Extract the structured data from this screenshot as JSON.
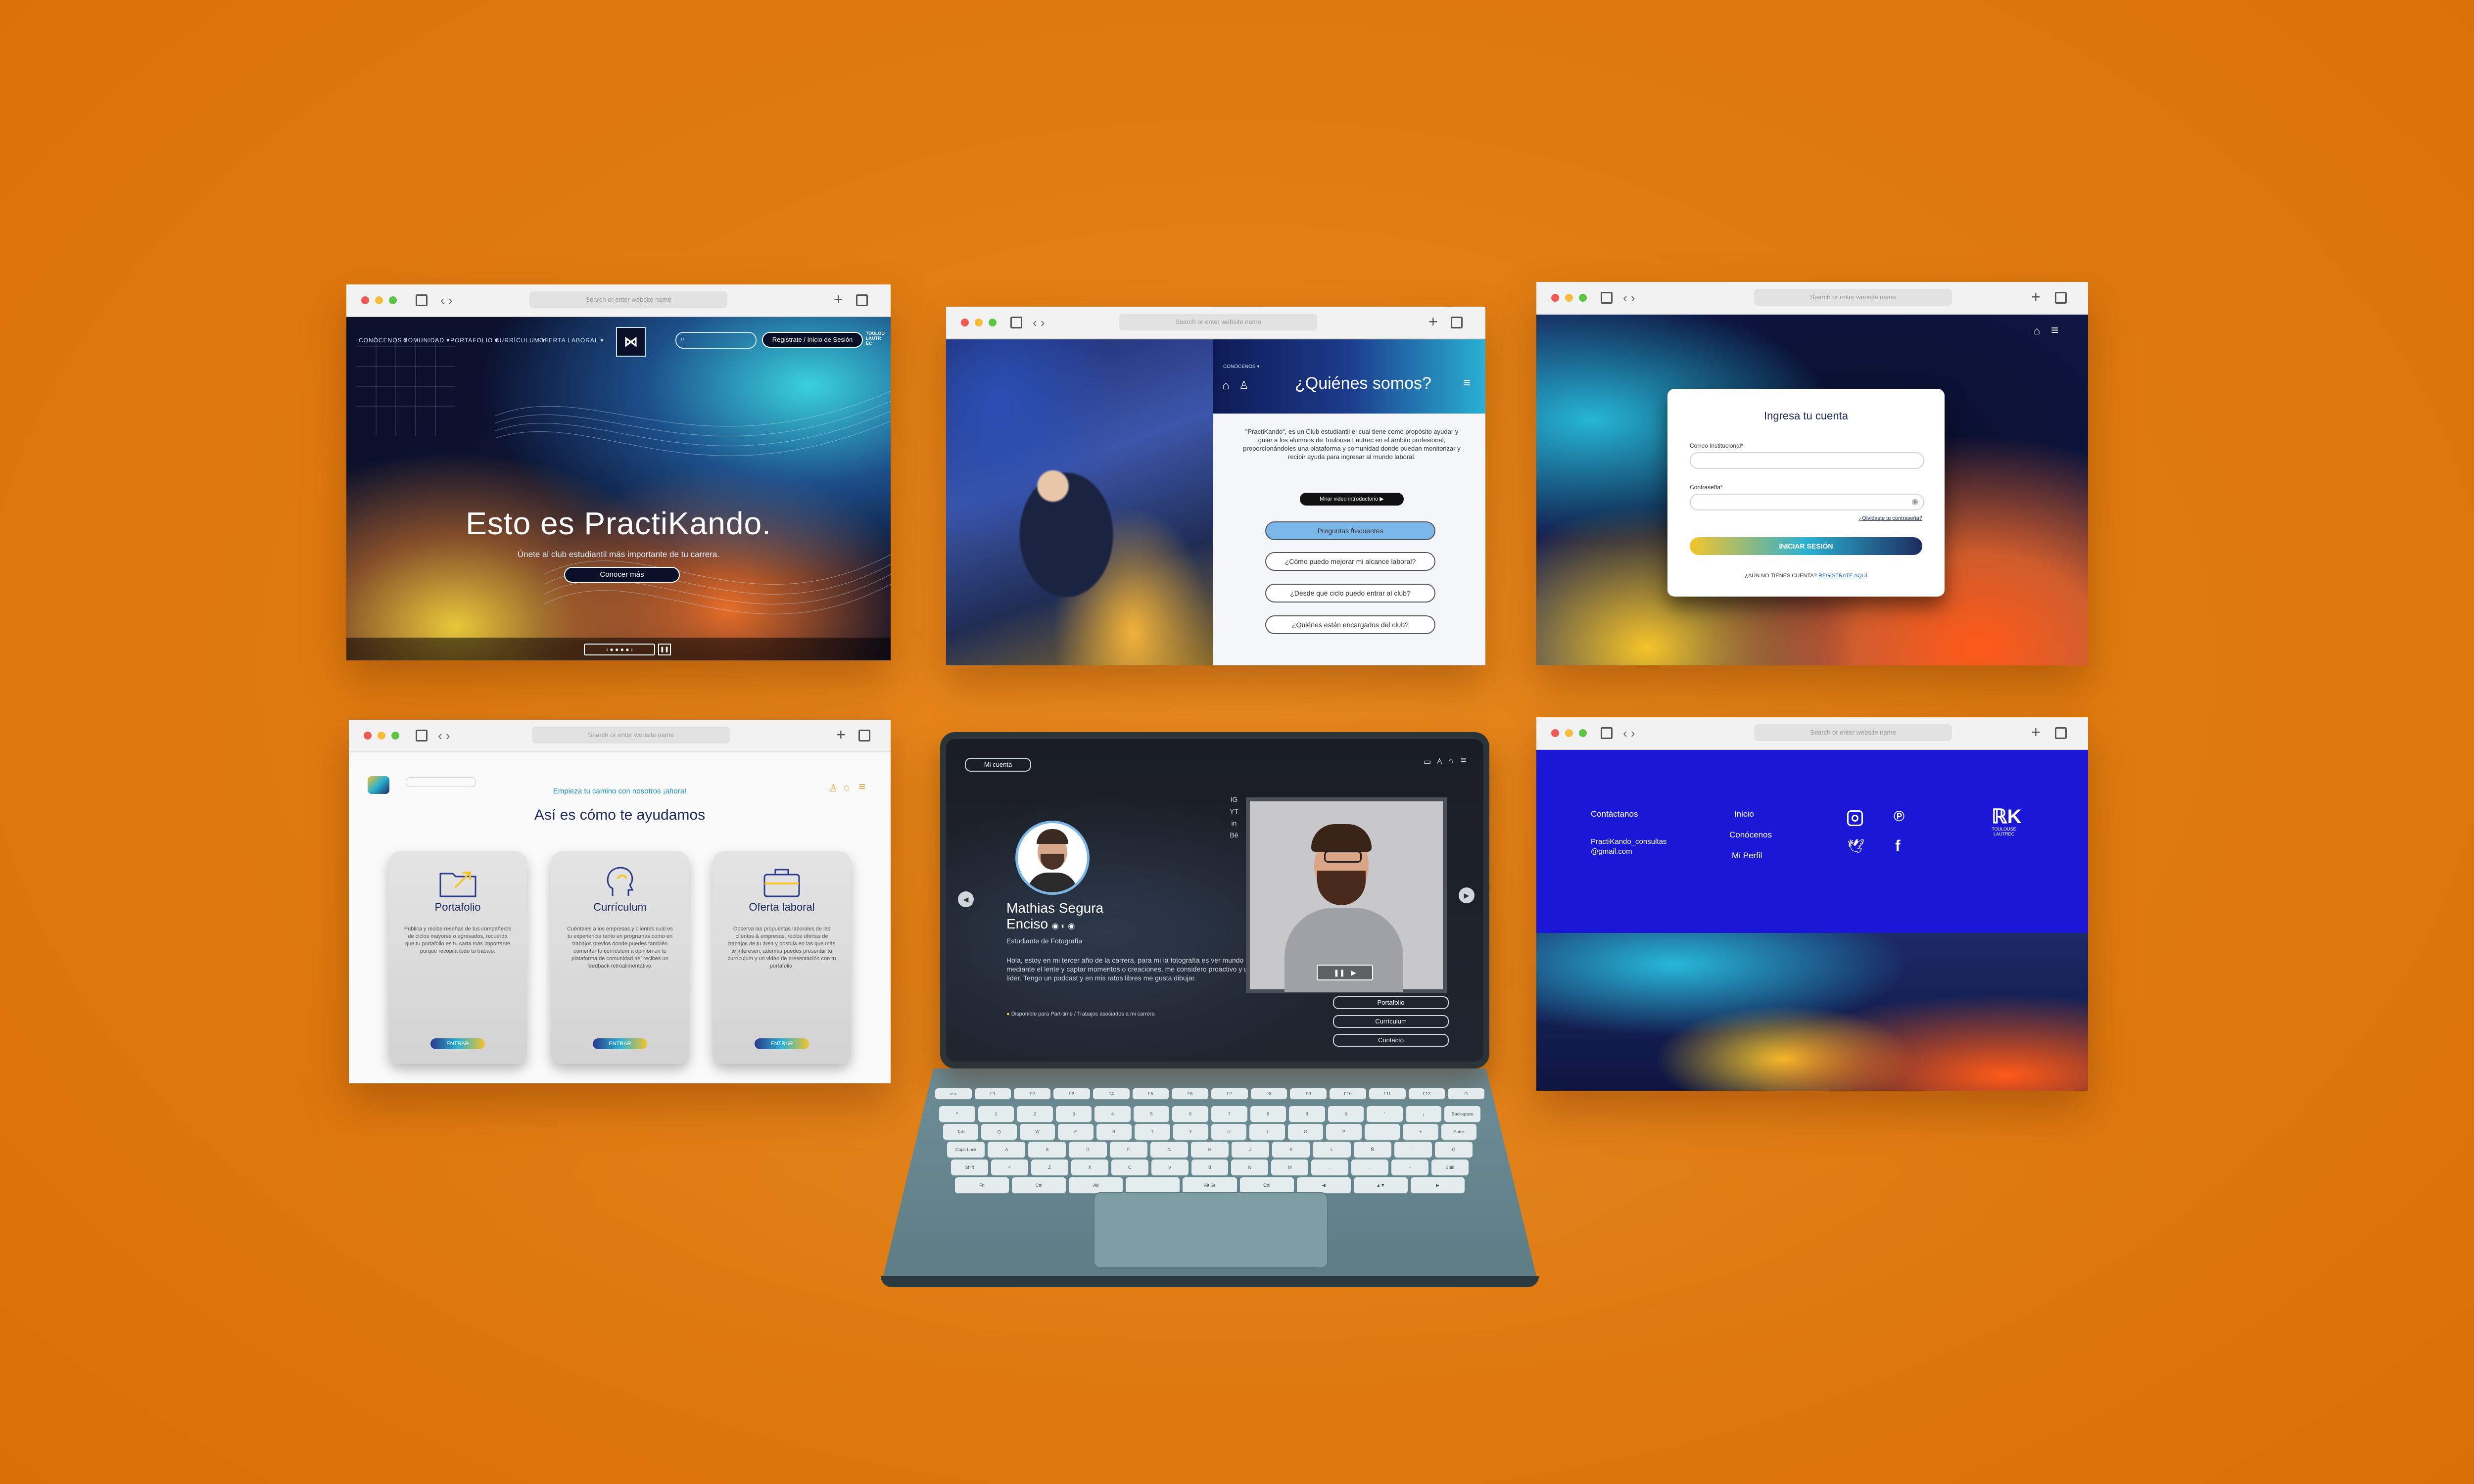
{
  "browser": {
    "url_placeholder": "Search or enter website name"
  },
  "hero": {
    "nav": [
      "CONÓCENOS ▾",
      "COMUNIDAD ▾",
      "PORTAFOLIO ▾",
      "CURRÍCULUM ▾",
      "OFERTA LABORAL ▾"
    ],
    "register": "Regístrate / Inicio de Sesión",
    "title": "Esto es PractiKando.",
    "subtitle": "Únete al club estudiantil más importante de tu carrera.",
    "cta": "Conocer más"
  },
  "about": {
    "breadcrumb": "CONÓCENOS ▾",
    "title": "¿Quiénes somos?",
    "text": "\"PractiKando\", es un Club estudiantil el cual tiene como propósito ayudar y guiar a los alumnos de Toulouse Lautrec en el ámbito profesional, proporcionándoles una plataforma y comunidad donde puedan monitorizar y recibir ayuda para ingresar al mundo laboral.",
    "video": "Mirar video introductorio",
    "faq_title": "Preguntas frecuentes",
    "faqs": [
      "¿Cómo puedo mejorar mi alcance laboral?",
      "¿Desde que ciclo puedo entrar al club?",
      "¿Quiénes están encargados del club?"
    ]
  },
  "login": {
    "title": "Ingresa tu cuenta",
    "email_label": "Correo Institucional*",
    "password_label": "Contraseña*",
    "forgot": "¿Olvidaste tu contraseña?",
    "submit": "INICIAR SESIÓN",
    "no_account": "¿AÚN NO TIENES CUENTA?",
    "register": "REGÍSTRATE AQUÍ"
  },
  "services": {
    "tagline": "Empieza tu camino con nosotros ¡ahora!",
    "heading": "Así es cómo te ayudamos",
    "cards": [
      {
        "title": "Portafolio",
        "desc": "Publica y recibe reseñas de tus compañeros de ciclos mayores o egresados, recuerda que tu portafolio es tu carta más importante porque recopila todo tu trabajo.",
        "button": "ENTRAR"
      },
      {
        "title": "Currículum",
        "desc": "Cuéntales a los empresas y clientes cuál es tu experiencia tanto en programas como en trabajos previos donde puedes también comentar tu currículum a opinión en tu plataforma de comunidad así recibes un feedback retroalimentativo.",
        "button": "ENTRAR"
      },
      {
        "title": "Oferta laboral",
        "desc": "Observa las propuestas laborales de las clientas & empresas, recibe ofertas de trabajos de tu área y postula en las que más te interesen, además puedes presentar tu currículum y un video de presentación con tu portafolio.",
        "button": "ENTRAR"
      }
    ]
  },
  "profile": {
    "account": "Mi cuenta",
    "name_line1": "Mathias Segura",
    "name_line2": "Enciso",
    "role": "Estudiante de Fotografía",
    "bio": "Hola, estoy en mi tercer año de la carrera, para mí la fotografía es ver mundo mediante el lente y captar momentos o creaciones, me considero proactivo y un líder. Tengo un podcast y en mis ratos libres me gusta dibujar.",
    "availability": "Disponible para Part-time / Trabajos asociados a mi carrera",
    "social": [
      "IG",
      "YT",
      "in",
      "Bē"
    ],
    "links": [
      "Portafolio",
      "Currículum",
      "Contacto"
    ]
  },
  "footer": {
    "contact_title": "Contáctanos",
    "email": "PractiKando_consultas @gmail.com",
    "links": [
      "Inicio",
      "Conócenos",
      "Mi Perfil"
    ],
    "brand": "TOULOUSE LAUTREC"
  },
  "keyboard": {
    "row1": [
      "esc",
      "F1",
      "F2",
      "F3",
      "F4",
      "F5",
      "F6",
      "F7",
      "F8",
      "F9",
      "F10",
      "F11",
      "F12",
      "⏻"
    ],
    "row2": [
      "º",
      "1",
      "2",
      "3",
      "4",
      "5",
      "6",
      "7",
      "8",
      "9",
      "0",
      "'",
      "¡",
      "Backspace"
    ],
    "row3": [
      "Tab",
      "Q",
      "W",
      "E",
      "R",
      "T",
      "Y",
      "U",
      "I",
      "O",
      "P",
      "`",
      "+",
      "Enter"
    ],
    "row4": [
      "Caps Lock",
      "A",
      "S",
      "D",
      "F",
      "G",
      "H",
      "J",
      "K",
      "L",
      "Ñ",
      "´",
      "Ç"
    ],
    "row5": [
      "Shift",
      "<",
      "Z",
      "X",
      "C",
      "V",
      "B",
      "N",
      "M",
      ",",
      ".",
      "-",
      "Shift"
    ],
    "row6": [
      "Fn",
      "Ctrl",
      "Alt",
      "",
      "Alt Gr",
      "Ctrl",
      "◀",
      "▲▼",
      "▶"
    ]
  }
}
